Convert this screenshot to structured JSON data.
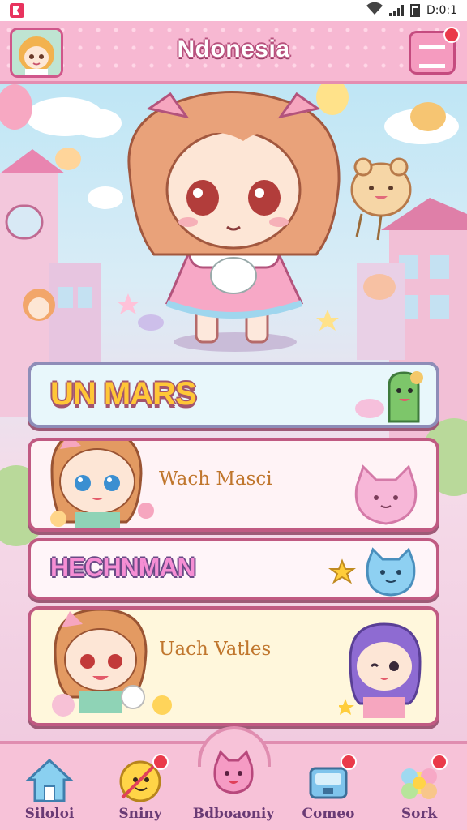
{
  "status_bar": {
    "time": "D:0:1"
  },
  "header": {
    "title": "Ndonesia",
    "menu_badge": ""
  },
  "menu": {
    "cards": [
      {
        "label": "UN MARS"
      },
      {
        "label": "Wach Masci"
      },
      {
        "label": "HECHNMAN"
      },
      {
        "label": "Uach Vatles"
      }
    ]
  },
  "bottom_nav": {
    "items": [
      {
        "label": "Siloloi",
        "icon": "home-icon"
      },
      {
        "label": "Sniny",
        "icon": "coin-icon"
      },
      {
        "label": "Bdboaoniy",
        "icon": "pet-icon"
      },
      {
        "label": "Comeo",
        "icon": "chest-icon"
      },
      {
        "label": "Sork",
        "icon": "flower-icon"
      }
    ],
    "badges": [
      "",
      "",
      ""
    ]
  },
  "colors": {
    "accent": "#f7b8d2",
    "border": "#c05a82",
    "gold": "#ffc737",
    "text": "#6a3b75"
  }
}
